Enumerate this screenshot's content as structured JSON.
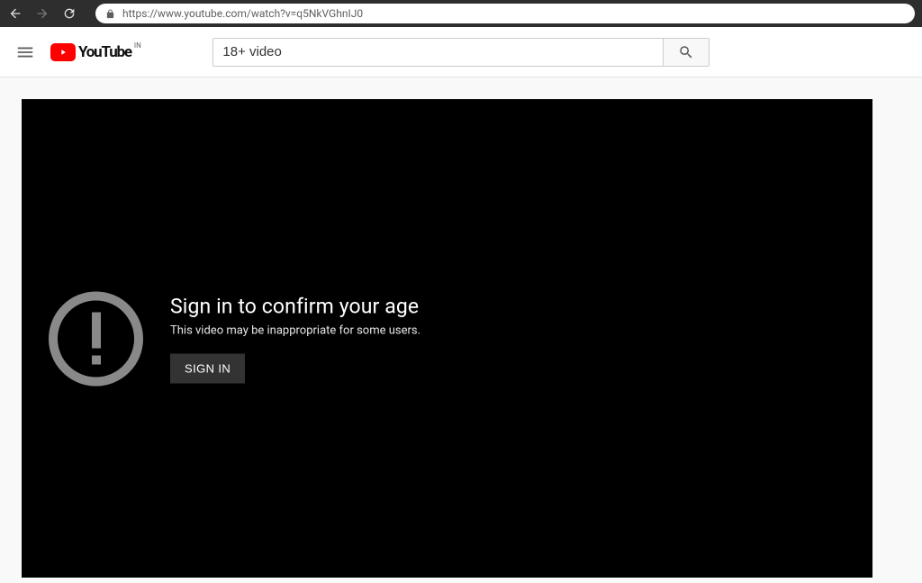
{
  "browser": {
    "url": "https://www.youtube.com/watch?v=q5NkVGhnIJ0"
  },
  "header": {
    "logo_text": "YouTube",
    "country_code": "IN",
    "search_value": "18+ video"
  },
  "player": {
    "age_gate": {
      "title": "Sign in to confirm your age",
      "subtitle": "This video may be inappropriate for some users.",
      "button_label": "SIGN IN"
    }
  }
}
